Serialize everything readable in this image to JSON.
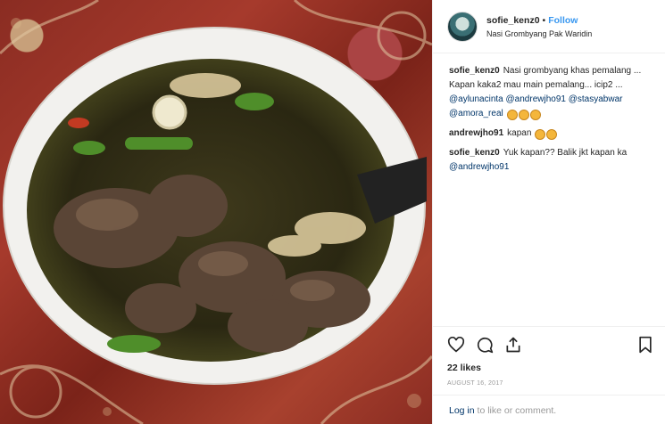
{
  "header": {
    "username": "sofie_kenz0",
    "separator": "•",
    "follow_label": "Follow",
    "location": "Nasi Grombyang Pak Waridin"
  },
  "comments": [
    {
      "username": "sofie_kenz0",
      "text": "Nasi grombyang khas pemalang ... Kapan kaka2 mau main pemalang... icip2 ...",
      "mentions": [
        "@aylunacinta",
        "@andrewjho91",
        "@stasyabwar",
        "@amora_real"
      ],
      "emoji_count": 3
    },
    {
      "username": "andrewjho91",
      "text": "kapan",
      "emoji_count": 2
    },
    {
      "username": "sofie_kenz0",
      "text": "Yuk kapan?? Balik jkt kapan ka",
      "mentions": [
        "@andrewjho91"
      ]
    }
  ],
  "actions": {
    "icons": [
      "heart-icon",
      "comment-icon",
      "share-icon",
      "bookmark-icon"
    ],
    "likes": "22 likes",
    "date": "AUGUST 16, 2017"
  },
  "login": {
    "link": "Log in",
    "text": " to like or comment."
  },
  "colors": {
    "link_blue": "#3897f0",
    "mention_navy": "#003569",
    "muted": "#999999"
  }
}
